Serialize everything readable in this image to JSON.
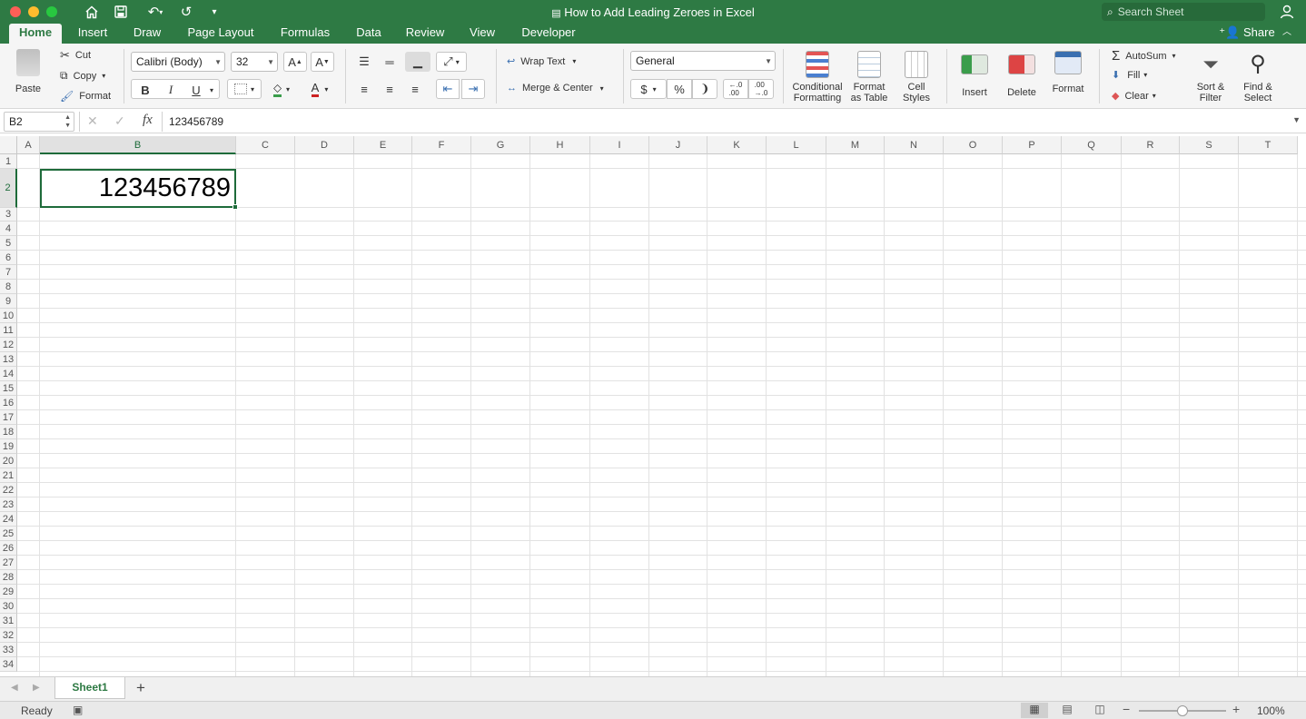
{
  "window": {
    "title": "How to Add Leading Zeroes in Excel",
    "search_placeholder": "Search Sheet"
  },
  "tabs": [
    "Home",
    "Insert",
    "Draw",
    "Page Layout",
    "Formulas",
    "Data",
    "Review",
    "View",
    "Developer"
  ],
  "share_label": "Share",
  "ribbon": {
    "paste": "Paste",
    "cut": "Cut",
    "copy": "Copy",
    "format_painter": "Format",
    "font_name": "Calibri (Body)",
    "font_size": "32",
    "bold": "B",
    "italic": "I",
    "underline": "U",
    "wrap_text": "Wrap Text",
    "merge_center": "Merge & Center",
    "number_format": "General",
    "conditional_formatting": [
      "Conditional",
      "Formatting"
    ],
    "format_as_table": [
      "Format",
      "as Table"
    ],
    "cell_styles": [
      "Cell",
      "Styles"
    ],
    "insert": "Insert",
    "delete": "Delete",
    "format": "Format",
    "autosum": "AutoSum",
    "fill": "Fill",
    "clear": "Clear",
    "sort_filter": [
      "Sort &",
      "Filter"
    ],
    "find_select": [
      "Find &",
      "Select"
    ]
  },
  "formula_bar": {
    "name_box": "B2",
    "fx": "fx",
    "content": "123456789"
  },
  "grid": {
    "columns": [
      "A",
      "B",
      "C",
      "D",
      "E",
      "F",
      "G",
      "H",
      "I",
      "J",
      "K",
      "L",
      "M",
      "N",
      "O",
      "P",
      "Q",
      "R",
      "S",
      "T"
    ],
    "rows": [
      "1",
      "2",
      "3",
      "4",
      "5",
      "6",
      "7",
      "8",
      "9",
      "10",
      "11",
      "12",
      "13",
      "14",
      "15",
      "16",
      "17",
      "18",
      "19",
      "20",
      "21",
      "22",
      "23",
      "24",
      "25",
      "26",
      "27",
      "28",
      "29",
      "30",
      "31",
      "32",
      "33",
      "34"
    ],
    "active_cell": "B2",
    "cell_b2": "123456789"
  },
  "sheets": [
    "Sheet1"
  ],
  "status": {
    "ready": "Ready",
    "zoom": "100%"
  },
  "colors": {
    "accent": "#2e7a44",
    "selection_border": "#1e6b3a"
  }
}
